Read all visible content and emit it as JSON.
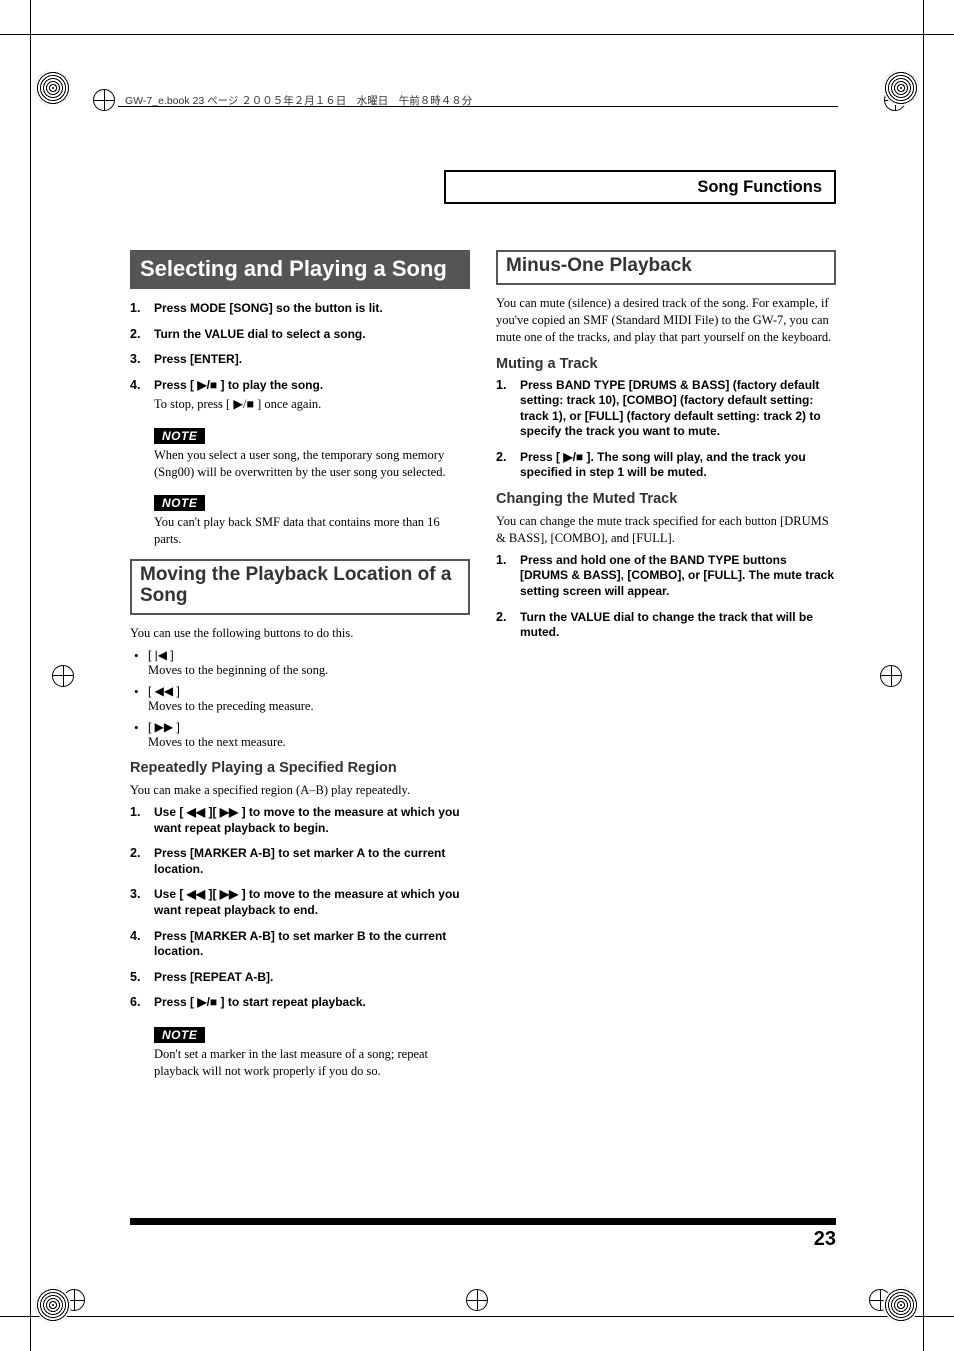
{
  "header": {
    "breadcrumb": "GW-7_e.book 23 ページ ２００５年２月１６日　水曜日　午前８時４８分",
    "section_title": "Song Functions"
  },
  "left": {
    "h1": "Selecting and Playing a Song",
    "steps1": [
      {
        "n": "1.",
        "text": "Press MODE [SONG] so the button is lit."
      },
      {
        "n": "2.",
        "text": "Turn the VALUE dial to select a song."
      },
      {
        "n": "3.",
        "text": "Press [ENTER]."
      },
      {
        "n": "4.",
        "text": "Press [ ▶/■ ] to play the song.",
        "sub": "To stop, press [ ▶/■ ] once again."
      }
    ],
    "note1_label": "NOTE",
    "note1": "When you select a user song, the temporary song memory (Sng00) will be overwritten by the user song you selected.",
    "note2_label": "NOTE",
    "note2": "You can't play back SMF data that contains more than 16 parts.",
    "h2": "Moving the Playback Location of a Song",
    "intro2": "You can use the following buttons to do this.",
    "moves": [
      {
        "icon": "[ |◀ ]",
        "desc": "Moves to the beginning of the song."
      },
      {
        "icon": "[ ◀◀ ]",
        "desc": "Moves to the preceding measure."
      },
      {
        "icon": "[ ▶▶ ]",
        "desc": "Moves to the next measure."
      }
    ],
    "h3": "Repeatedly Playing a Specified Region",
    "intro3": "You can make a specified region (A–B) play repeatedly.",
    "steps3": [
      {
        "n": "1.",
        "text": "Use [ ◀◀ ][ ▶▶ ] to move to the measure at which you want repeat playback to begin."
      },
      {
        "n": "2.",
        "text": "Press [MARKER A-B] to set marker A to the current location."
      },
      {
        "n": "3.",
        "text": "Use [ ◀◀ ][ ▶▶ ] to move to the measure at which you want repeat playback to end."
      },
      {
        "n": "4.",
        "text": "Press [MARKER A-B] to set marker B to the current location."
      },
      {
        "n": "5.",
        "text": "Press [REPEAT A-B]."
      },
      {
        "n": "6.",
        "text": "Press [ ▶/■ ] to start repeat playback."
      }
    ],
    "note3_label": "NOTE",
    "note3": "Don't set a marker in the last measure of a song; repeat playback will not work properly if you do so."
  },
  "right": {
    "h2": "Minus-One Playback",
    "intro": "You can mute (silence) a desired track of the song. For example, if you've copied an SMF (Standard MIDI File) to the GW-7, you can mute one of the tracks, and play that part yourself on the keyboard.",
    "h3a": "Muting a Track",
    "stepsA": [
      {
        "n": "1.",
        "text": "Press BAND TYPE [DRUMS & BASS] (factory default setting: track 10), [COMBO] (factory default setting: track 1), or [FULL] (factory default setting: track 2) to specify the track you want to mute."
      },
      {
        "n": "2.",
        "text": "Press [ ▶/■ ]. The song will play, and the track you specified in step 1 will be muted."
      }
    ],
    "h3b": "Changing the Muted Track",
    "introB": "You can change the mute track specified for each button [DRUMS & BASS], [COMBO], and [FULL].",
    "stepsB": [
      {
        "n": "1.",
        "text": "Press and hold one of the BAND TYPE buttons [DRUMS & BASS], [COMBO], or [FULL]. The mute track setting screen will appear."
      },
      {
        "n": "2.",
        "text": "Turn the VALUE dial to change the track that will be muted."
      }
    ]
  },
  "page_number": "23"
}
